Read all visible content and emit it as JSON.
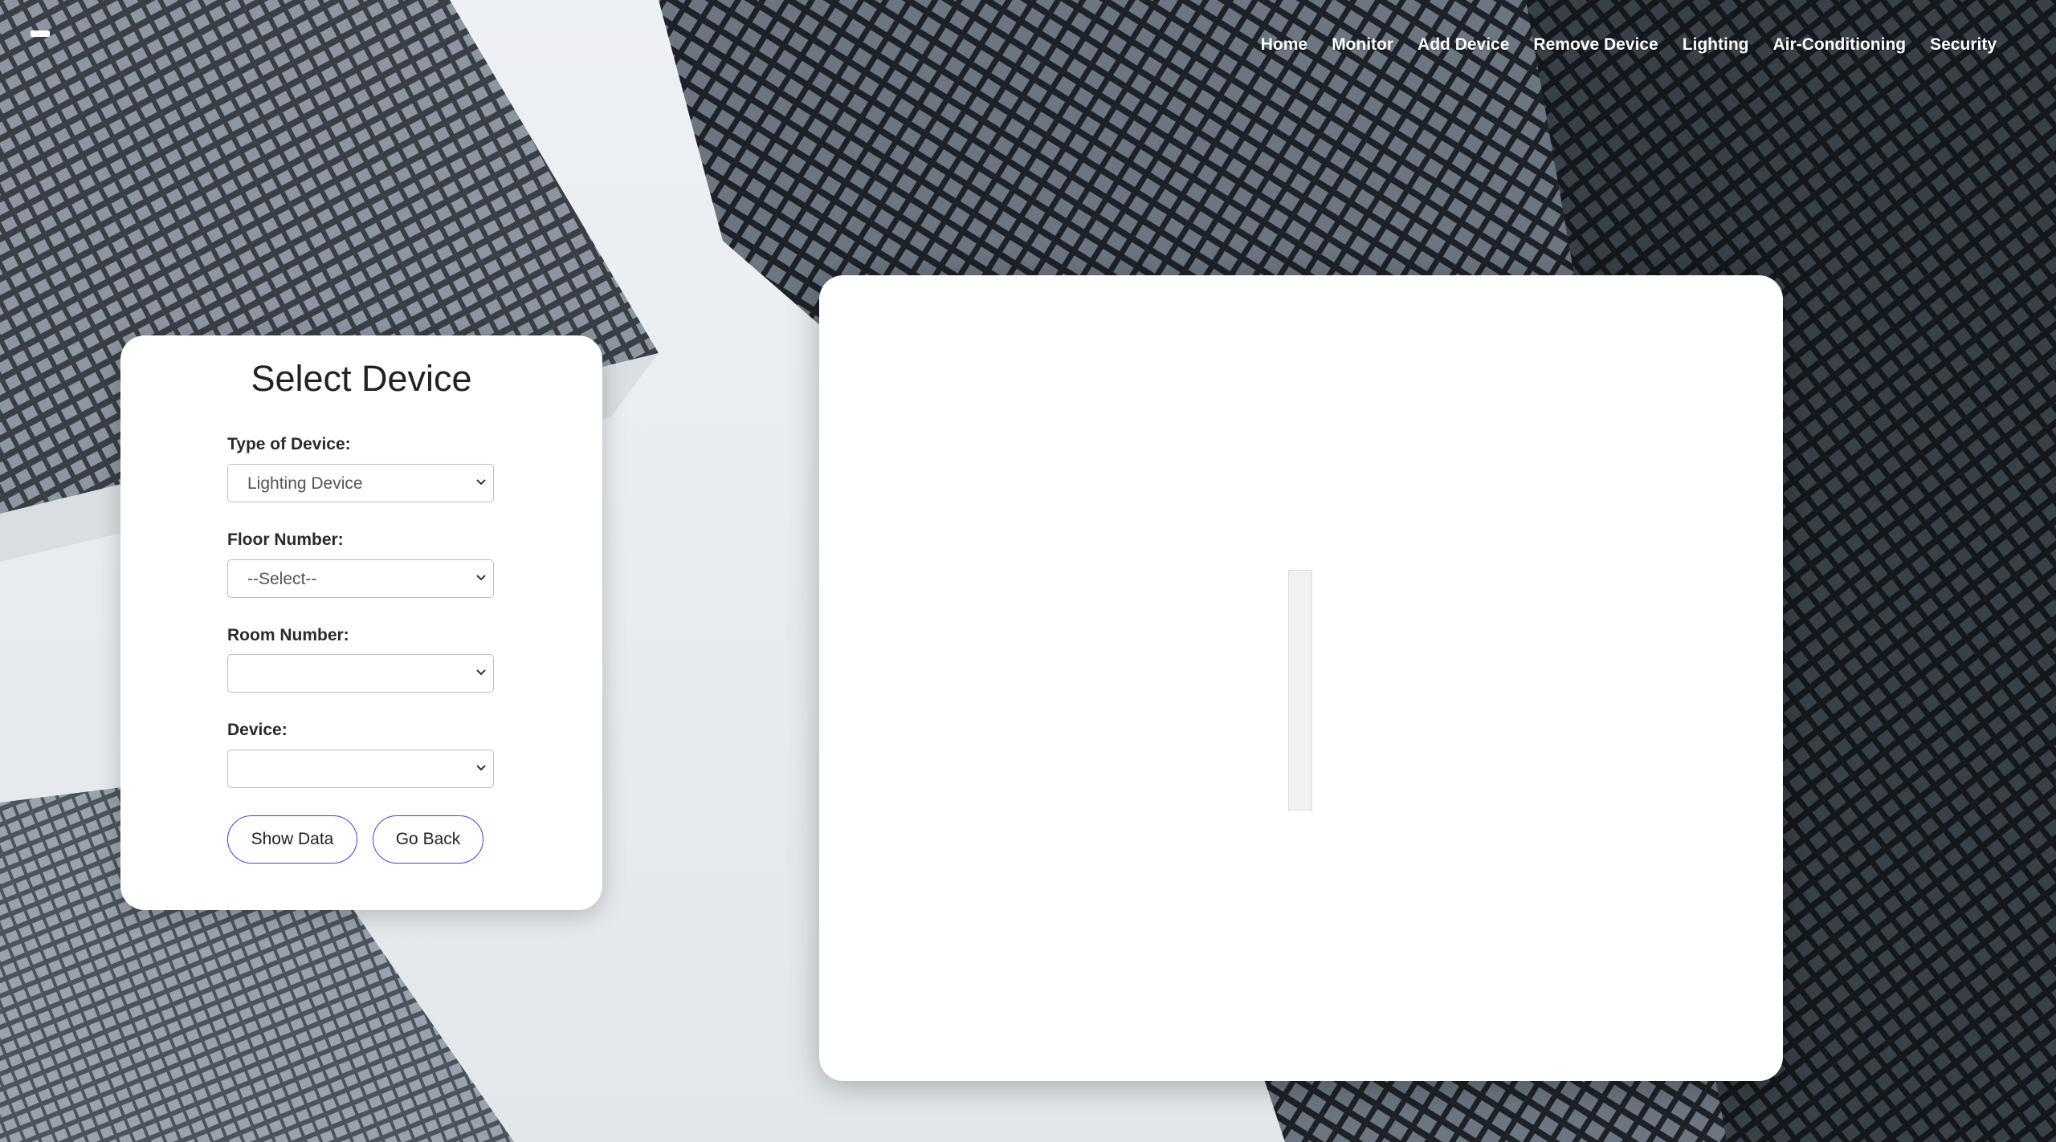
{
  "nav": {
    "items": [
      "Home",
      "Monitor",
      "Add Device",
      "Remove Device",
      "Lighting",
      "Air-Conditioning",
      "Security"
    ]
  },
  "form": {
    "title": "Select Device",
    "type_label": "Type of Device:",
    "type_value": "Lighting Device",
    "floor_label": "Floor Number:",
    "floor_value": "--Select--",
    "room_label": "Room Number:",
    "room_value": "",
    "device_label": "Device:",
    "device_value": "",
    "show_button": "Show Data",
    "back_button": "Go Back"
  }
}
